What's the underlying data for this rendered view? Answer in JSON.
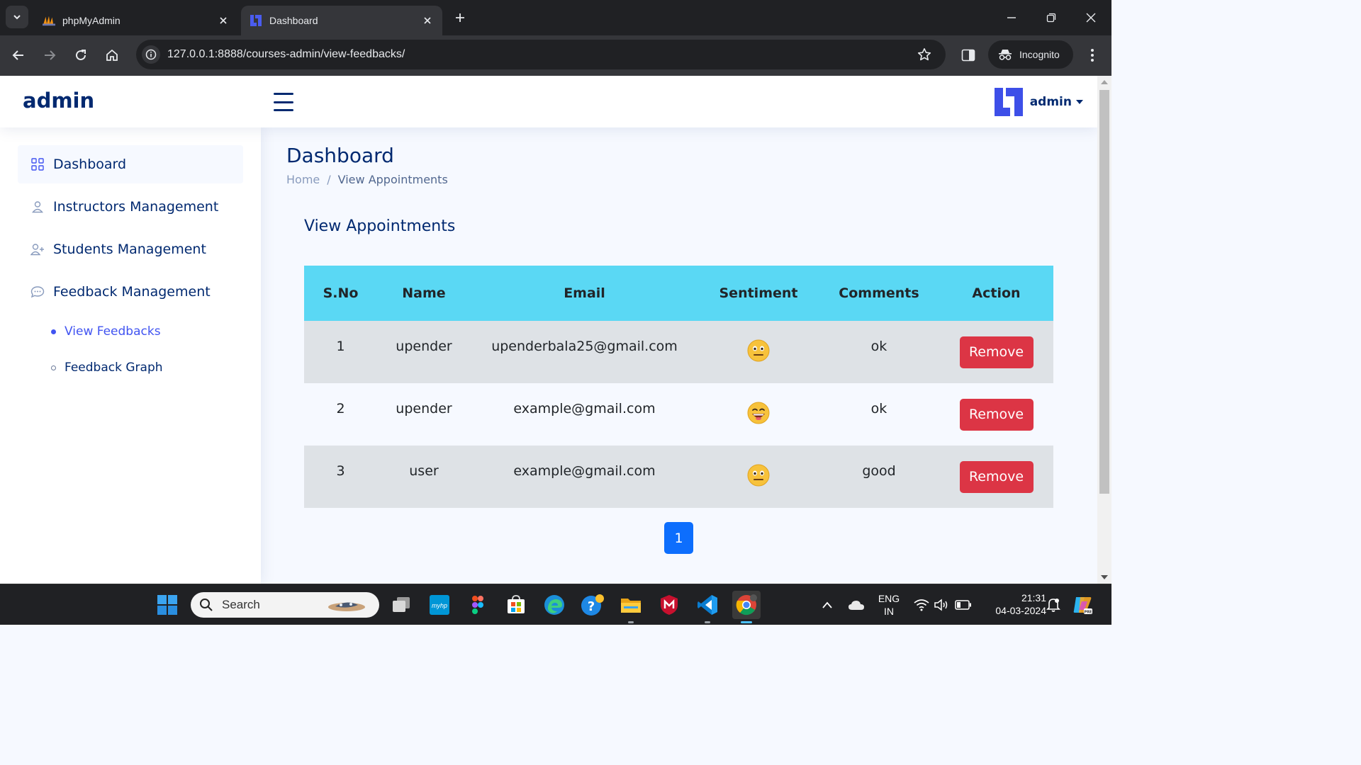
{
  "browser": {
    "tabs": [
      {
        "title": "phpMyAdmin",
        "active": false
      },
      {
        "title": "Dashboard",
        "active": true
      }
    ],
    "url": "127.0.0.1:8888/courses-admin/view-feedbacks/",
    "profile_label": "Incognito"
  },
  "header": {
    "brand": "admin",
    "user_name": "admin"
  },
  "sidebar": {
    "items": [
      {
        "label": "Dashboard",
        "icon": "grid-icon",
        "active": true
      },
      {
        "label": "Instructors Management",
        "icon": "person-icon"
      },
      {
        "label": "Students Management",
        "icon": "person-add-icon"
      },
      {
        "label": "Feedback Management",
        "icon": "chat-icon"
      }
    ],
    "sub_items": [
      {
        "label": "View Feedbacks",
        "active": true
      },
      {
        "label": "Feedback Graph",
        "active": false
      }
    ]
  },
  "page": {
    "title": "Dashboard",
    "breadcrumb": [
      "Home",
      "View Appointments"
    ],
    "section_title": "View Appointments"
  },
  "table": {
    "headers": [
      "S.No",
      "Name",
      "Email",
      "Sentiment",
      "Comments",
      "Action"
    ],
    "rows": [
      {
        "sno": "1",
        "name": "upender",
        "email": "upenderbala25@gmail.com",
        "sentiment": "neutral-face-emoji",
        "comments": "ok",
        "action": "Remove"
      },
      {
        "sno": "2",
        "name": "upender",
        "email": "example@gmail.com",
        "sentiment": "grinning-face-emoji",
        "comments": "ok",
        "action": "Remove"
      },
      {
        "sno": "3",
        "name": "user",
        "email": "example@gmail.com",
        "sentiment": "neutral-face-emoji",
        "comments": "good",
        "action": "Remove"
      }
    ]
  },
  "pagination": {
    "current": "1"
  },
  "taskbar": {
    "search_placeholder": "Search",
    "language": "ENG",
    "region": "IN",
    "time": "21:31",
    "date": "04-03-2024"
  },
  "colors": {
    "brand": "#012970",
    "table_header": "#5ad8f4",
    "remove_button": "#dc3545",
    "pager": "#0d6efd",
    "active_sub": "#4154f1"
  }
}
